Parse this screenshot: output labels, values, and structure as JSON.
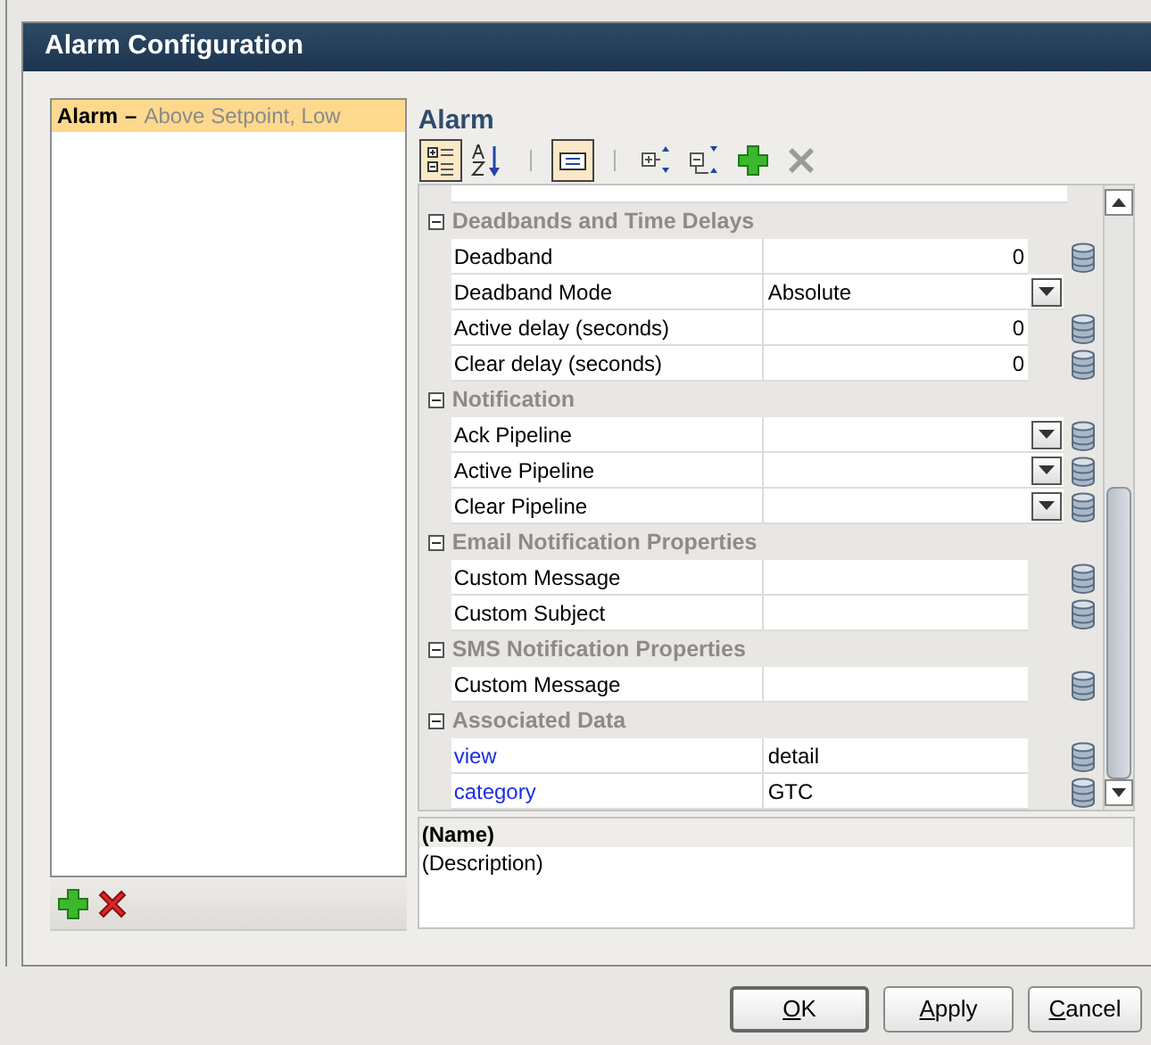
{
  "dialog": {
    "title": "Alarm Configuration"
  },
  "alarm_list": {
    "items": [
      {
        "name": "Alarm",
        "separator": "–",
        "description": "Above Setpoint, Low",
        "selected": true
      }
    ]
  },
  "editor": {
    "title": "Alarm",
    "toolbar": [
      {
        "kind": "categorized",
        "pressed": true
      },
      {
        "kind": "alphabetical",
        "pressed": false
      },
      {
        "kind": "separator"
      },
      {
        "kind": "description",
        "pressed": true
      },
      {
        "kind": "separator"
      },
      {
        "kind": "expand",
        "pressed": false
      },
      {
        "kind": "collapse",
        "pressed": false
      },
      {
        "kind": "add",
        "pressed": false
      },
      {
        "kind": "remove",
        "pressed": false
      }
    ],
    "rows": [
      {
        "kind": "group",
        "label": "Deadbands and Time Delays",
        "expanded": true
      },
      {
        "kind": "property",
        "name": "Deadband",
        "value": "0",
        "numeric": true,
        "dropdown": false,
        "bindable": true,
        "custom": false
      },
      {
        "kind": "property",
        "name": "Deadband Mode",
        "value": "Absolute",
        "numeric": false,
        "dropdown": true,
        "bindable": false,
        "custom": false
      },
      {
        "kind": "property",
        "name": "Active delay (seconds)",
        "value": "0",
        "numeric": true,
        "dropdown": false,
        "bindable": true,
        "custom": false
      },
      {
        "kind": "property",
        "name": "Clear delay (seconds)",
        "value": "0",
        "numeric": true,
        "dropdown": false,
        "bindable": true,
        "custom": false
      },
      {
        "kind": "group",
        "label": "Notification",
        "expanded": true
      },
      {
        "kind": "property",
        "name": "Ack Pipeline",
        "numeric": false,
        "dropdown": true,
        "bindable": true,
        "custom": false
      },
      {
        "kind": "property",
        "name": "Active Pipeline",
        "numeric": false,
        "dropdown": true,
        "bindable": true,
        "custom": false
      },
      {
        "kind": "property",
        "name": "Clear Pipeline",
        "numeric": false,
        "dropdown": true,
        "bindable": true,
        "custom": false
      },
      {
        "kind": "group",
        "label": "Email Notification Properties",
        "expanded": true
      },
      {
        "kind": "property",
        "name": "Custom Message",
        "numeric": false,
        "dropdown": false,
        "bindable": true,
        "custom": false
      },
      {
        "kind": "property",
        "name": "Custom Subject",
        "numeric": false,
        "dropdown": false,
        "bindable": true,
        "custom": false
      },
      {
        "kind": "group",
        "label": "SMS Notification Properties",
        "expanded": true
      },
      {
        "kind": "property",
        "name": "Custom Message",
        "numeric": false,
        "dropdown": false,
        "bindable": true,
        "custom": false
      },
      {
        "kind": "group",
        "label": "Associated Data",
        "expanded": true
      },
      {
        "kind": "property",
        "name": "view",
        "value": "detail",
        "numeric": false,
        "dropdown": false,
        "bindable": true,
        "custom": true
      },
      {
        "kind": "property",
        "name": "category",
        "value": "GTC",
        "numeric": false,
        "dropdown": false,
        "bindable": true,
        "custom": true
      }
    ],
    "description_panel": {
      "name": "(Name)",
      "description": "(Description)"
    }
  },
  "buttons": [
    {
      "label": "OK",
      "mnemonic_first": true,
      "default": true
    },
    {
      "label": "Apply",
      "mnemonic_first": true,
      "default": false
    },
    {
      "label": "Cancel",
      "mnemonic_first": true,
      "default": false
    }
  ]
}
